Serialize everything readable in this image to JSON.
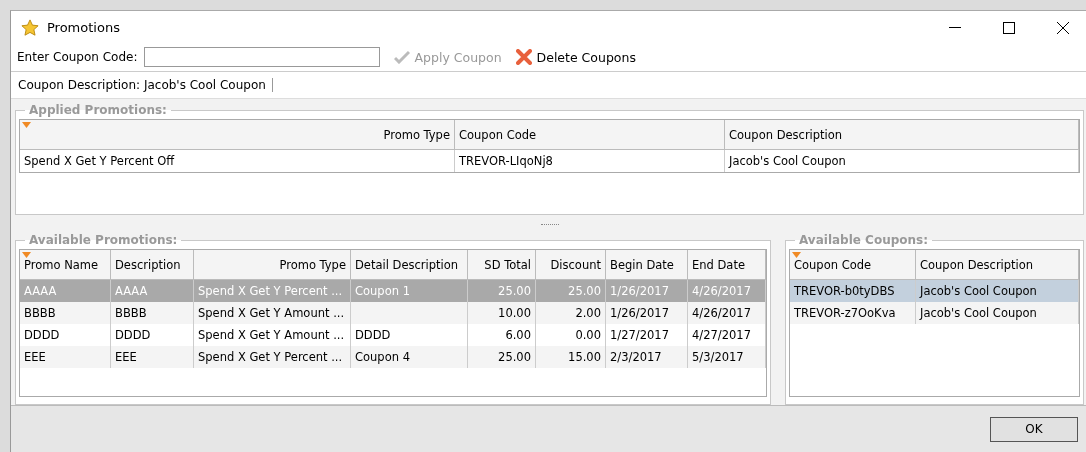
{
  "window": {
    "title": "Promotions"
  },
  "coupon_entry": {
    "label": "Enter Coupon Code:"
  },
  "toolbar": [
    {
      "kind": "apply",
      "label": "Apply Coupon",
      "disabled": true
    },
    {
      "kind": "delete",
      "label": "Delete Coupons",
      "disabled": false
    }
  ],
  "coupon_description": "Coupon Description: Jacob's Cool Coupon",
  "applied_promotions": {
    "title": "Applied Promotions:",
    "columns": [
      "Promo Type",
      "Coupon Code",
      "Coupon Description"
    ],
    "rows": [
      {
        "cells": [
          "Spend X Get Y Percent Off",
          "TREVOR-LIqoNj8",
          "Jacob's Cool Coupon"
        ],
        "selected": false
      }
    ]
  },
  "available_promotions": {
    "title": "Available Promotions:",
    "columns": [
      "Promo Name",
      "Description",
      "Promo Type",
      "Detail Description",
      "SD Total",
      "Discount",
      "Begin Date",
      "End Date"
    ],
    "rows": [
      {
        "cells": [
          "AAAA",
          "AAAA",
          "Spend X Get Y Percent ...",
          "Coupon 1",
          "25.00",
          "25.00",
          "1/26/2017",
          "4/26/2017"
        ],
        "selected": true
      },
      {
        "cells": [
          "BBBB",
          "BBBB",
          "Spend X Get Y Amount ...",
          "",
          "10.00",
          "2.00",
          "1/26/2017",
          "4/26/2017"
        ],
        "selected": false
      },
      {
        "cells": [
          "DDDD",
          "DDDD",
          "Spend X Get Y Amount ...",
          "DDDD",
          "6.00",
          "0.00",
          "1/27/2017",
          "4/27/2017"
        ],
        "selected": false
      },
      {
        "cells": [
          "EEE",
          "EEE",
          "Spend X Get Y Percent ...",
          "Coupon 4",
          "25.00",
          "15.00",
          "2/3/2017",
          "5/3/2017"
        ],
        "selected": false
      }
    ]
  },
  "available_coupons": {
    "title": "Available Coupons:",
    "columns": [
      "Coupon Code",
      "Coupon Description"
    ],
    "rows": [
      {
        "cells": [
          "TREVOR-b0tyDBS",
          "Jacob's Cool Coupon"
        ],
        "selected": true
      },
      {
        "cells": [
          "TREVOR-z7OoKva",
          "Jacob's Cool Coupon"
        ],
        "selected": false
      }
    ]
  },
  "buttons": [
    "OK"
  ]
}
